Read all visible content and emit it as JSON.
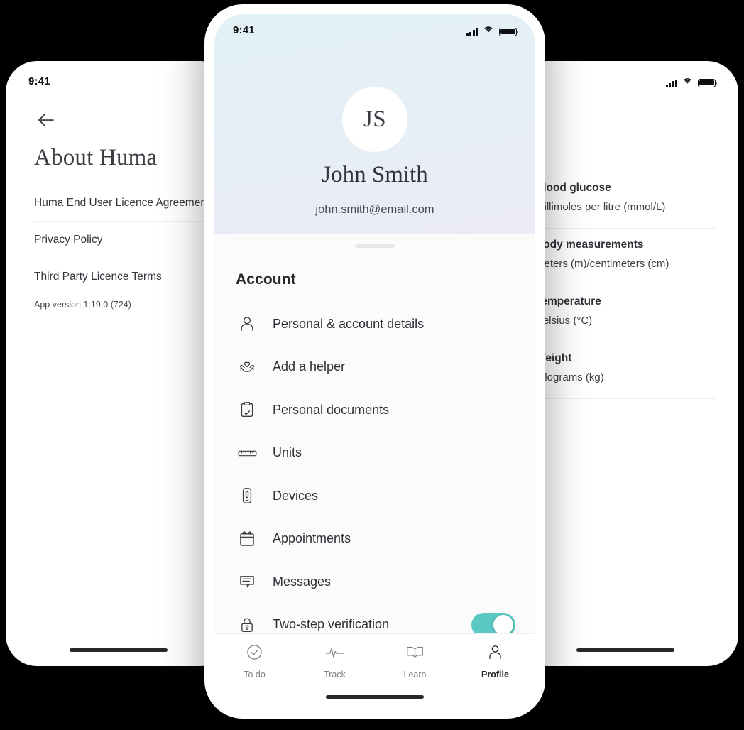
{
  "left_phone": {
    "status_bar": {
      "time": "9:41"
    },
    "back_icon": "arrow-left-icon",
    "title": "About Huma",
    "rows": [
      {
        "label": "Huma End User Licence Agreement"
      },
      {
        "label": "Privacy Policy"
      },
      {
        "label": "Third Party Licence Terms"
      }
    ],
    "app_version": "App version 1.19.0 (724)"
  },
  "right_phone": {
    "status_bar": {
      "time": "",
      "signal_icon": "signal-bars-icon",
      "wifi_icon": "wifi-icon",
      "battery_icon": "battery-icon"
    },
    "rows": [
      {
        "title": "Blood glucose",
        "value": "Millimoles per litre (mmol/L)"
      },
      {
        "title": "Body measurements",
        "value": "Meters (m)/centimeters (cm)"
      },
      {
        "title": "Temperature",
        "value": "Celsius (°C)"
      },
      {
        "title": "Weight",
        "value": "Kilograms (kg)"
      }
    ]
  },
  "center_phone": {
    "status_bar": {
      "time": "9:41",
      "signal_icon": "signal-bars-icon",
      "wifi_icon": "wifi-icon",
      "battery_icon": "battery-icon"
    },
    "profile": {
      "initials": "JS",
      "name": "John Smith",
      "email": "john.smith@email.com"
    },
    "sheet": {
      "title": "Account",
      "items": [
        {
          "label": "Personal & account details",
          "icon": "person-icon",
          "toggle": null
        },
        {
          "label": "Add a helper",
          "icon": "heart-in-hands-icon",
          "toggle": null
        },
        {
          "label": "Personal documents",
          "icon": "clipboard-check-icon",
          "toggle": null
        },
        {
          "label": "Units",
          "icon": "ruler-icon",
          "toggle": null
        },
        {
          "label": "Devices",
          "icon": "mobile-device-icon",
          "toggle": null
        },
        {
          "label": "Appointments",
          "icon": "calendar-icon",
          "toggle": null
        },
        {
          "label": "Messages",
          "icon": "message-bubble-icon",
          "toggle": null
        },
        {
          "label": "Two-step verification",
          "icon": "lock-icon",
          "toggle": "on"
        }
      ]
    },
    "tabbar": {
      "tabs": [
        {
          "label": "To do",
          "icon": "check-circle-icon",
          "active": false
        },
        {
          "label": "Track",
          "icon": "pulse-icon",
          "active": false
        },
        {
          "label": "Learn",
          "icon": "book-icon",
          "active": false
        },
        {
          "label": "Profile",
          "icon": "person-icon",
          "active": true
        }
      ]
    }
  },
  "colors": {
    "toggle_on": "#5cc8c4",
    "background": "#000000",
    "header_gradient_start": "#e2f1f5",
    "header_gradient_end": "#ecebf6"
  }
}
